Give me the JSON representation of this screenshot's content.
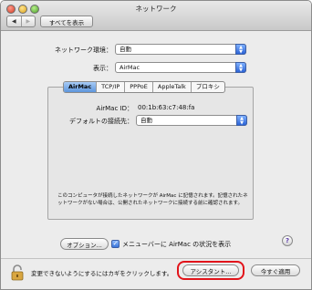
{
  "window": {
    "title": "ネットワーク",
    "back_arrow": "◀",
    "forward_arrow": "▶",
    "show_all_label": "すべてを表示"
  },
  "network_location": {
    "label": "ネットワーク環境：",
    "value": "自動"
  },
  "show": {
    "label": "表示：",
    "value": "AirMac"
  },
  "tabs": [
    {
      "label": "AirMac",
      "selected": true
    },
    {
      "label": "TCP/IP",
      "selected": false
    },
    {
      "label": "PPPoE",
      "selected": false
    },
    {
      "label": "AppleTalk",
      "selected": false
    },
    {
      "label": "プロキシ",
      "selected": false
    }
  ],
  "airmac": {
    "id_label": "AirMac ID：",
    "id_value": "00:1b:63:c7:48:fa",
    "default_connect_label": "デフォルトの接続先：",
    "default_connect_value": "自動",
    "info_text": "このコンピュータが接続したネットワークが AirMac に記憶されます。記憶されたネットワークがない場合は、公開されたネットワークに接続する前に確認されます。"
  },
  "controls": {
    "options_label": "オプション...",
    "menubar_checkbox_label": "メニューバーに AirMac の状況を表示",
    "menubar_checkbox_checked": true,
    "help_label": "?"
  },
  "footer": {
    "lock_text": "変更できないようにするにはカギをクリックします。",
    "assistant_label": "アシスタント...",
    "apply_now_label": "今すぐ適用"
  },
  "colors": {
    "highlight": "#e2141b",
    "accent": "#3a74d9"
  }
}
